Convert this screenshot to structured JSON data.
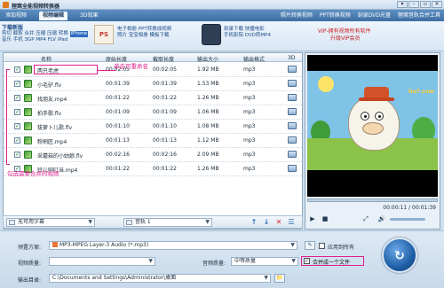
{
  "window": {
    "title": "狸窝全能视频转换器",
    "controls": [
      "▾",
      "–",
      "▫",
      "✕"
    ]
  },
  "tabs": [
    "添加视频",
    "视频编辑",
    "3D效果"
  ],
  "top_links": [
    "照片转换视频",
    "PPT转换视频",
    "刻录DVD光盘",
    "狸窝音轨合并工具"
  ],
  "promo": {
    "download_label": "下载新版",
    "format_rows": [
      {
        "items": [
          "剪切",
          "截取",
          "合并",
          "压缩",
          "压缩",
          "转换"
        ],
        "badge": "iPhone"
      },
      {
        "items": [
          "音乐",
          "手机",
          "3GP",
          "MP4",
          "FLV",
          "iPad"
        ],
        "badge": ""
      }
    ],
    "ps_icon": "PS",
    "promo_line1": "电子相册  PPT转换成视频",
    "promo_line2": "照片  宝宝相册  模板下载",
    "promo_line3": "刻录下载  快播电影",
    "promo_line4": "手机影院  DVD转MP4",
    "vip_line1": "VIP-拥有视频所有软件",
    "vip_line2": "升级VIP会员"
  },
  "columns": [
    "名称",
    "原始长度",
    "截取长度",
    "输出大小",
    "输出格式",
    "3D"
  ],
  "files": [
    {
      "name": "两只老虎",
      "original": "00:02:05",
      "clip": "00:02:05",
      "size": "1.92 MB",
      "format": "mp3",
      "checked": "✓"
    },
    {
      "name": "小毛驴.flv",
      "original": "00:01:39",
      "clip": "00:01:39",
      "size": "1.53 MB",
      "format": "mp3",
      "checked": "✓"
    },
    {
      "name": "找朋友.mp4",
      "original": "00:01:22",
      "clip": "00:01:22",
      "size": "1.26 MB",
      "format": "mp3",
      "checked": "✓"
    },
    {
      "name": "拍手歌.flv",
      "original": "00:01:09",
      "clip": "00:01:09",
      "size": "1.06 MB",
      "format": "mp3",
      "checked": "✓"
    },
    {
      "name": "拔萝卜儿歌.flv",
      "original": "00:01:10",
      "clip": "00:01:10",
      "size": "1.08 MB",
      "format": "mp3",
      "checked": "✓"
    },
    {
      "name": "粉刷匠.mp4",
      "original": "00:01:13",
      "clip": "00:01:13",
      "size": "1.12 MB",
      "format": "mp3",
      "checked": "✓"
    },
    {
      "name": "采蘑菇的小姑娘.flv",
      "original": "00:02:16",
      "clip": "00:02:16",
      "size": "2.09 MB",
      "format": "mp3",
      "checked": "✓"
    },
    {
      "name": "铃儿响叮当.mp4",
      "original": "00:01:22",
      "clip": "00:01:22",
      "size": "1.26 MB",
      "format": "mp3",
      "checked": "✓"
    }
  ],
  "annotations": {
    "rename_hint": "单击可重命名",
    "select_hint": "勾选需要合并的视频"
  },
  "preview": {
    "watermark": "hu7.com",
    "timecode": "00:00:11 / 00:01:39",
    "buttons": [
      "▶",
      "■",
      "⤢",
      "🔊"
    ]
  },
  "file_toolbar": {
    "subtitle": "无可用字幕",
    "audio_track": "音轨 1",
    "buttons": [
      "↑",
      "↓",
      "✕",
      "☰"
    ]
  },
  "bottom": {
    "preset_label": "预置方案:",
    "preset_value": "MP3-MPEG Layer-3 Audio (*.mp3)",
    "video_quality_label": "视频质量:",
    "video_quality_value": "",
    "audio_quality_label": "音频质量:",
    "audio_quality_value": "中等质量",
    "output_dir_label": "输出目录:",
    "output_dir_value": "C:\\Documents and Settings\\Administrator\\桌面",
    "apply_all_label": "应用到所有",
    "merge_label": "合并成一个文件",
    "apply_all_checked": "",
    "merge_checked": "✓",
    "settings_btn": "✎",
    "folder_btn": "📁"
  },
  "colors": {
    "annotation": "#e01f8c",
    "accent": "#1f5fa6"
  }
}
